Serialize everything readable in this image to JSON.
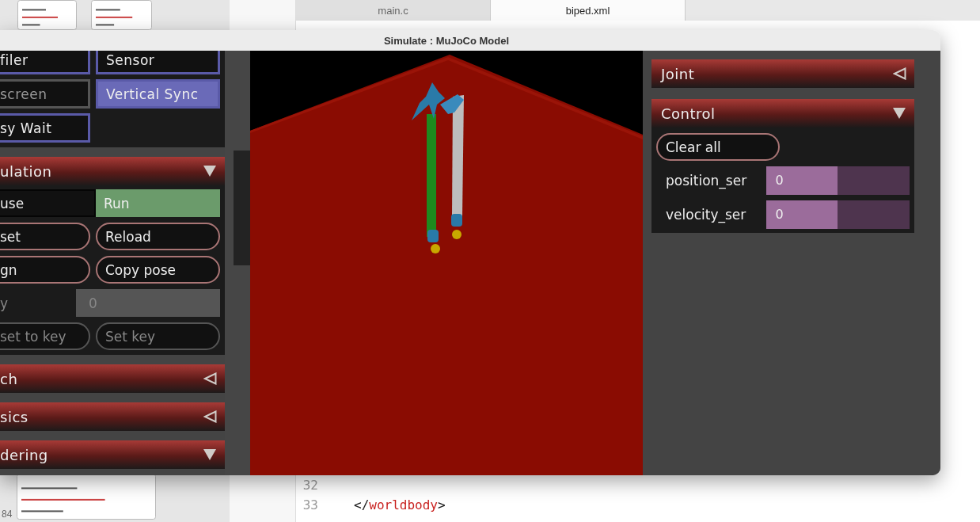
{
  "background": {
    "editor_tabs": [
      {
        "label": "main.c",
        "selected": false
      },
      {
        "label": "biped.xml",
        "selected": true
      }
    ],
    "code_bottom": [
      {
        "number": "32"
      },
      {
        "number": "33",
        "open": "</",
        "tag": "worldbody",
        "close": ">"
      }
    ],
    "slide_number": "84"
  },
  "window": {
    "title": "Simulate : MuJoCo Model"
  },
  "left_panel": {
    "toggles": [
      {
        "label": "filer",
        "on": false,
        "disabled": false
      },
      {
        "label": "Sensor",
        "on": false,
        "disabled": false
      },
      {
        "label": "screen",
        "on": false,
        "disabled": true
      },
      {
        "label": "Vertical Sync",
        "on": true,
        "disabled": false
      },
      {
        "label": "sy Wait",
        "on": false,
        "disabled": false
      }
    ],
    "sections": [
      {
        "title": "ulation",
        "expanded": true,
        "rows": [
          {
            "kind": "radio",
            "options": [
              {
                "label": "use",
                "selected": false
              },
              {
                "label": "Run",
                "selected": true
              }
            ]
          },
          {
            "kind": "buttons",
            "buttons": [
              {
                "label": "set",
                "disabled": false
              },
              {
                "label": "Reload",
                "disabled": false
              }
            ]
          },
          {
            "kind": "buttons",
            "buttons": [
              {
                "label": "gn",
                "disabled": false
              },
              {
                "label": "Copy pose",
                "disabled": false
              }
            ]
          },
          {
            "kind": "field",
            "label": "y",
            "value": "0",
            "disabled": true
          },
          {
            "kind": "buttons",
            "buttons": [
              {
                "label": "set to key",
                "disabled": true
              },
              {
                "label": "Set key",
                "disabled": true
              }
            ]
          }
        ]
      },
      {
        "title": "ch",
        "expanded": false
      },
      {
        "title": "sics",
        "expanded": false
      },
      {
        "title": "dering",
        "expanded": true
      }
    ]
  },
  "right_panel": {
    "sections": [
      {
        "title": "Joint",
        "expanded": false
      },
      {
        "title": "Control",
        "expanded": true,
        "rows": [
          {
            "kind": "button",
            "label": "Clear all"
          },
          {
            "kind": "slider",
            "label": "position_ser",
            "value": "0",
            "level": 0.5
          },
          {
            "kind": "slider",
            "label": "velocity_ser",
            "value": "0",
            "level": 0.5
          }
        ]
      }
    ]
  }
}
